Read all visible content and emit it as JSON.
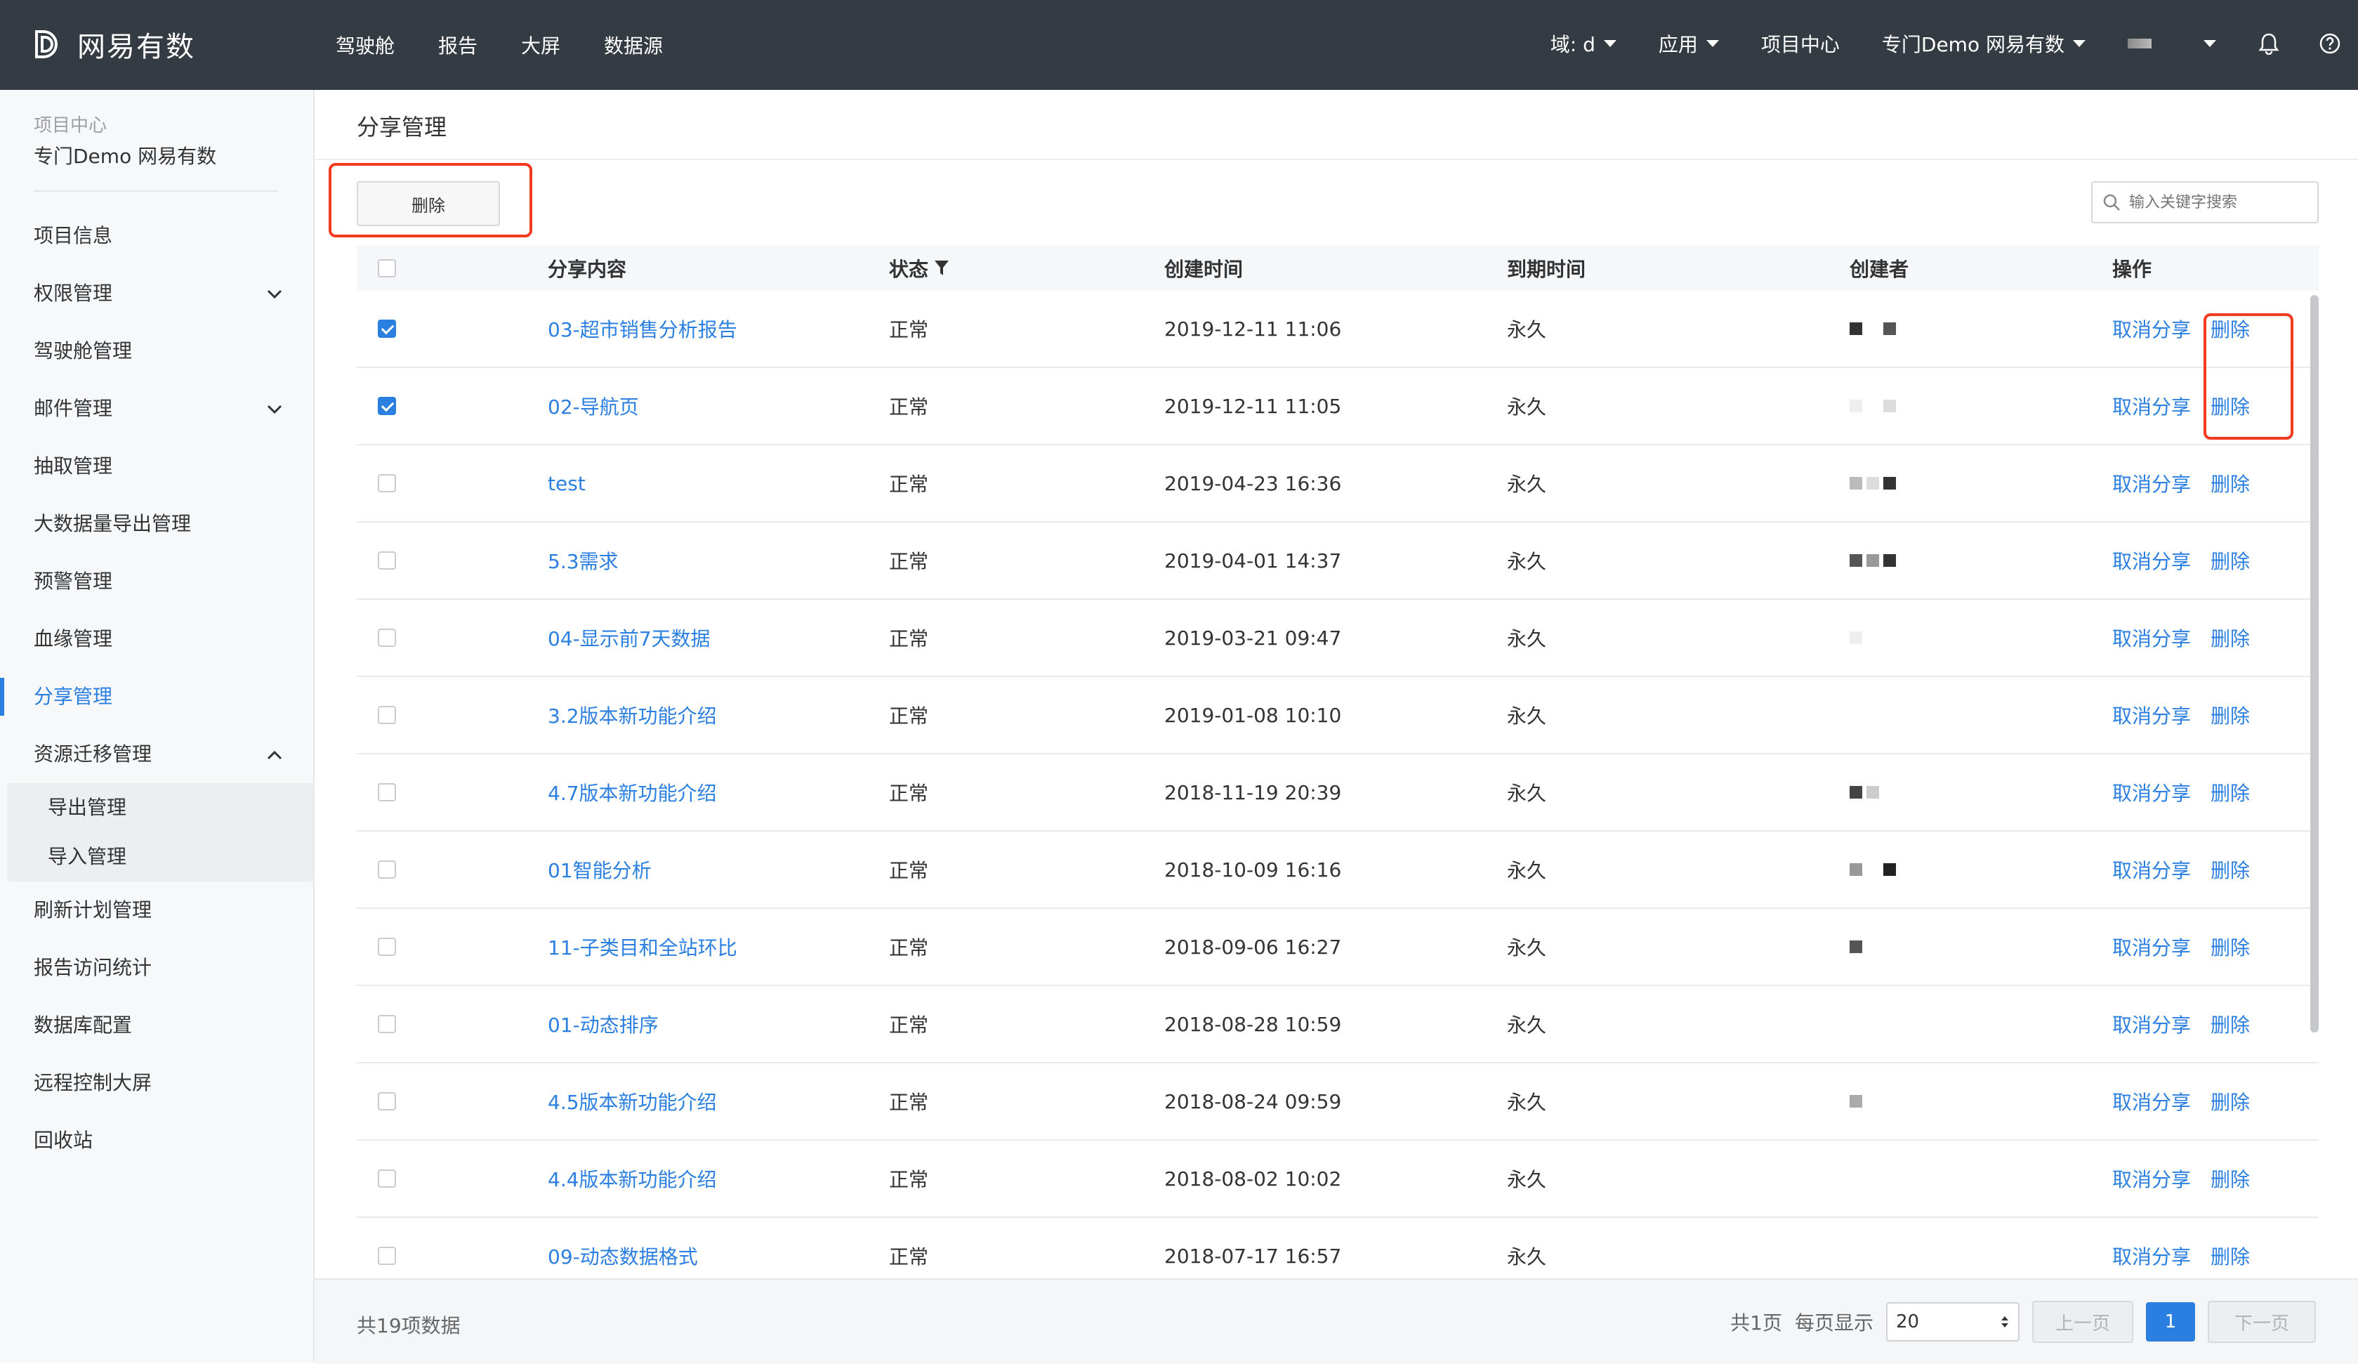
{
  "topbar": {
    "brand": "网易有数",
    "nav": [
      "驾驶舱",
      "报告",
      "大屏",
      "数据源"
    ],
    "domain_label": "域: d",
    "apps_label": "应用",
    "project_center": "项目中心",
    "project_selector": "专门Demo 网易有数"
  },
  "sidebar": {
    "project_sub": "项目中心",
    "project_name": "专门Demo 网易有数",
    "items": [
      {
        "label": "项目信息"
      },
      {
        "label": "权限管理",
        "chevron": "down"
      },
      {
        "label": "驾驶舱管理"
      },
      {
        "label": "邮件管理",
        "chevron": "down"
      },
      {
        "label": "抽取管理"
      },
      {
        "label": "大数据量导出管理"
      },
      {
        "label": "预警管理"
      },
      {
        "label": "血缘管理"
      },
      {
        "label": "分享管理",
        "active": true
      },
      {
        "label": "资源迁移管理",
        "chevron": "up"
      }
    ],
    "subitems": [
      "导出管理",
      "导入管理"
    ],
    "items_after": [
      "刷新计划管理",
      "报告访问统计",
      "数据库配置",
      "远程控制大屏",
      "回收站"
    ]
  },
  "main": {
    "title": "分享管理",
    "delete_button": "删除",
    "search_placeholder": "输入关键字搜索"
  },
  "table": {
    "headers": {
      "content": "分享内容",
      "status": "状态",
      "created": "创建时间",
      "expire": "到期时间",
      "creator": "创建者",
      "ops": "操作"
    },
    "op_cancel": "取消分享",
    "op_delete": "删除",
    "rows": [
      {
        "name": "03-超市销售分析报告",
        "status": "正常",
        "created": "2019-12-11 11:06",
        "expire": "永久",
        "checked": true
      },
      {
        "name": "02-导航页",
        "status": "正常",
        "created": "2019-12-11 11:05",
        "expire": "永久",
        "checked": true
      },
      {
        "name": "test",
        "status": "正常",
        "created": "2019-04-23 16:36",
        "expire": "永久",
        "checked": false
      },
      {
        "name": "5.3需求",
        "status": "正常",
        "created": "2019-04-01 14:37",
        "expire": "永久",
        "checked": false
      },
      {
        "name": "04-显示前7天数据",
        "status": "正常",
        "created": "2019-03-21 09:47",
        "expire": "永久",
        "checked": false
      },
      {
        "name": "3.2版本新功能介绍",
        "status": "正常",
        "created": "2019-01-08 10:10",
        "expire": "永久",
        "checked": false
      },
      {
        "name": "4.7版本新功能介绍",
        "status": "正常",
        "created": "2018-11-19 20:39",
        "expire": "永久",
        "checked": false
      },
      {
        "name": "01智能分析",
        "status": "正常",
        "created": "2018-10-09 16:16",
        "expire": "永久",
        "checked": false
      },
      {
        "name": "11-子类目和全站环比",
        "status": "正常",
        "created": "2018-09-06 16:27",
        "expire": "永久",
        "checked": false
      },
      {
        "name": "01-动态排序",
        "status": "正常",
        "created": "2018-08-28 10:59",
        "expire": "永久",
        "checked": false
      },
      {
        "name": "4.5版本新功能介绍",
        "status": "正常",
        "created": "2018-08-24 09:59",
        "expire": "永久",
        "checked": false
      },
      {
        "name": "4.4版本新功能介绍",
        "status": "正常",
        "created": "2018-08-02 10:02",
        "expire": "永久",
        "checked": false
      },
      {
        "name": "09-动态数据格式",
        "status": "正常",
        "created": "2018-07-17 16:57",
        "expire": "永久",
        "checked": false
      }
    ]
  },
  "footer": {
    "total": "共19项数据",
    "pages": "共1页",
    "per_page_label": "每页显示",
    "per_page_value": "20",
    "prev": "上一页",
    "current_page": "1",
    "next": "下一页"
  },
  "colors": {
    "topbar": "#343b42",
    "accent": "#2b7fe0",
    "highlight": "#f23a1f"
  }
}
